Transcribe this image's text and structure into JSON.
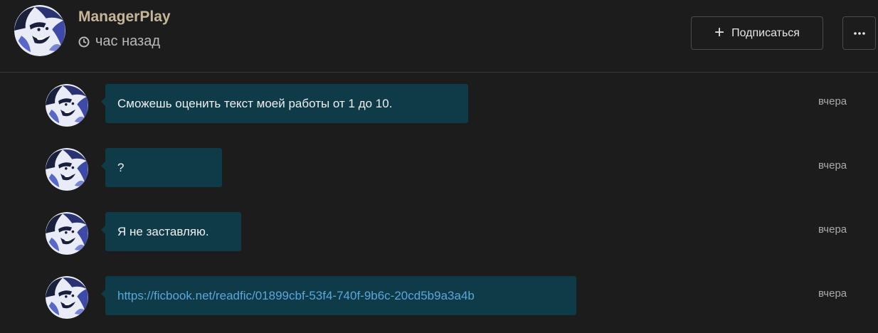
{
  "header": {
    "username": "ManagerPlay",
    "time_ago": "час назад",
    "subscribe_label": "Подписаться",
    "more_icon": "ellipsis-icon",
    "clock_icon": "clock-icon",
    "plus_icon": "plus-icon"
  },
  "colors": {
    "background": "#1c1c1c",
    "bubble": "#0f3a48",
    "username": "#c7b59a",
    "link": "#5aa7d8"
  },
  "messages": [
    {
      "text": "Сможешь оценить текст моей работы от 1 до 10.",
      "time": "вчера",
      "is_link": false
    },
    {
      "text": "?",
      "time": "вчера",
      "is_link": false
    },
    {
      "text": "Я не заставляю.",
      "time": "вчера",
      "is_link": false
    },
    {
      "text": "https://ficbook.net/readfic/01899cbf-53f4-740f-9b6c-20cd5b9a3a4b",
      "time": "вчера",
      "is_link": true
    }
  ]
}
